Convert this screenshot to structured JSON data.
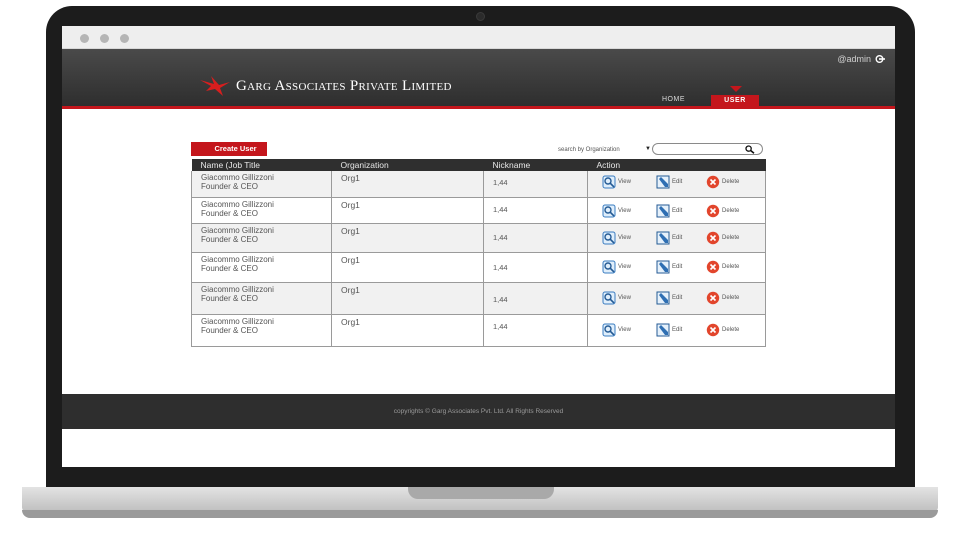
{
  "company": {
    "name": "Garg Associates Private Limited"
  },
  "header": {
    "admin_label": "@admin"
  },
  "nav": {
    "home": "HOME",
    "user": "USER"
  },
  "toolbar": {
    "create_user": "Create User",
    "search_label": "search by Organization",
    "search_placeholder": ""
  },
  "table": {
    "headers": [
      "Name (Job Title",
      "Organization",
      "Nickname",
      "Action"
    ],
    "rows": [
      {
        "name": "Giacommo Gillizzoni",
        "title": "Founder & CEO",
        "organization": "Org1",
        "nickname": "1,44"
      },
      {
        "name": "Giacommo Gillizzoni",
        "title": "Founder & CEO",
        "organization": "Org1",
        "nickname": "1,44"
      },
      {
        "name": "Giacommo Gillizzoni",
        "title": "Founder & CEO",
        "organization": "Org1",
        "nickname": "1,44"
      },
      {
        "name": "Giacommo Gillizzoni",
        "title": "Founder & CEO",
        "organization": "Org1",
        "nickname": "1,44"
      },
      {
        "name": "Giacommo Gillizzoni",
        "title": "Founder & CEO",
        "organization": "Org1",
        "nickname": "1,44"
      },
      {
        "name": "Giacommo Gillizzoni",
        "title": "Founder & CEO",
        "organization": "Org1",
        "nickname": "1,44"
      }
    ],
    "actions": {
      "view": "View",
      "edit": "Edit",
      "delete": "Delete"
    }
  },
  "footer": {
    "text": "copyrights © Garg Associates Pvt. Ltd. All Rights Reserved"
  },
  "colors": {
    "accent": "#c4161c",
    "header_bg": "#3a3a3a",
    "footer_bg": "#2e2e2e"
  },
  "icons": {
    "logo": "red-bird-logo-icon",
    "logout": "logout-icon",
    "search": "magnifier-icon",
    "view": "magnifier-view-icon",
    "edit": "pencil-edit-icon",
    "delete": "red-x-delete-icon"
  }
}
